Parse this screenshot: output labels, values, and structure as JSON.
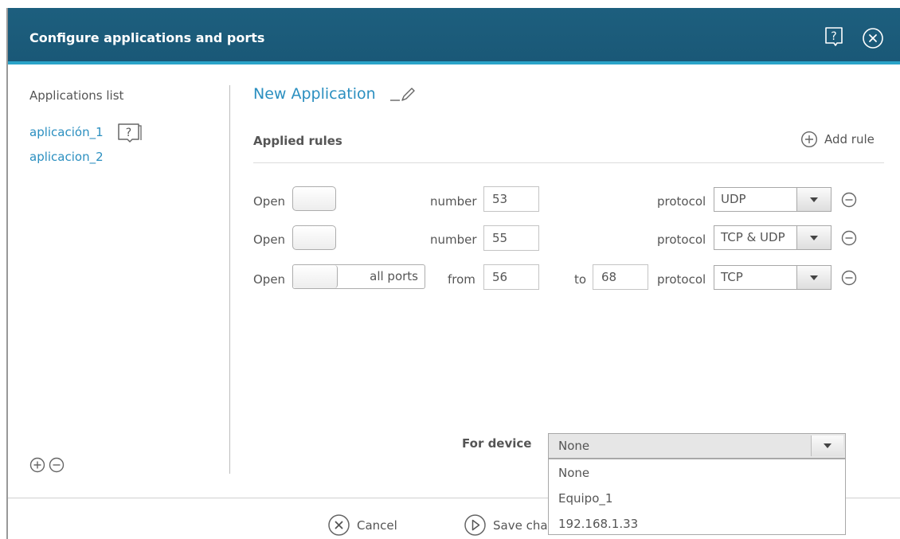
{
  "window": {
    "title": "Configure applications and ports",
    "help_icon": "help-icon",
    "close_icon": "close-icon"
  },
  "sidebar": {
    "title": "Applications list",
    "items": [
      {
        "label": "aplicación_1",
        "icon": "help-icon"
      },
      {
        "label": "aplicacion_2"
      }
    ],
    "add_icon": "add-icon",
    "remove_icon": "remove-icon"
  },
  "main": {
    "app_name": "New Application",
    "edit_icon": "pencil-icon",
    "applied_rules_label": "Applied rules",
    "add_rule_label": "Add rule",
    "rules": [
      {
        "open_label": "Open",
        "number_label": "number",
        "number": "53",
        "protocol_label": "protocol",
        "protocol": "UDP"
      },
      {
        "open_label": "Open",
        "number_label": "number",
        "number": "55",
        "protocol_label": "protocol",
        "protocol": "TCP & UDP"
      },
      {
        "open_label": "Open",
        "toggle_label": "all ports",
        "from_label": "from",
        "from": "56",
        "to_label": "to",
        "to": "68",
        "protocol_label": "protocol",
        "protocol": "TCP"
      }
    ],
    "device": {
      "label": "For device",
      "selected": "None",
      "options": [
        "None",
        "Equipo_1",
        "192.168.1.33"
      ]
    }
  },
  "footer": {
    "cancel_label": "Cancel",
    "save_label": "Save cha"
  },
  "colors": {
    "title_bar": "#1d5f7e",
    "accent": "#2b8fc0",
    "title_underline": "#2aa3c8"
  }
}
